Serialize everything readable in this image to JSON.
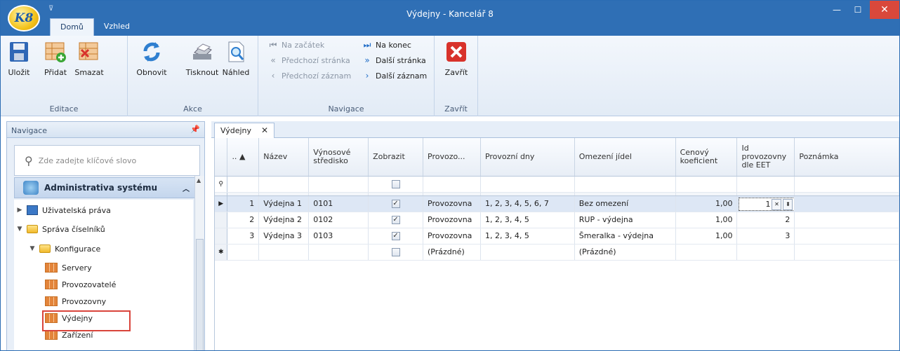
{
  "window": {
    "title": "Výdejny - Kancelář 8",
    "logo_text": "K8",
    "qat_symbol": "⊽"
  },
  "ribbon_tabs": [
    "Domů",
    "Vzhled"
  ],
  "ribbon": {
    "editace": {
      "label": "Editace",
      "save": "Uložit",
      "add": "Přidat",
      "delete": "Smazat"
    },
    "akce": {
      "label": "Akce",
      "refresh": "Obnovit",
      "print": "Tisknout",
      "preview": "Náhled"
    },
    "navigace": {
      "label": "Navigace",
      "first": "Na začátek",
      "prev_page": "Předchozí stránka",
      "prev_record": "Předchozí záznam",
      "last": "Na konec",
      "next_page": "Další stránka",
      "next_record": "Další záznam"
    },
    "zavrit": {
      "label": "Zavřít",
      "close": "Zavřít"
    }
  },
  "nav": {
    "header": "Navigace",
    "search_placeholder": "Zde zadejte klíčové slovo",
    "section": "Administrativa systému",
    "items": {
      "uzivatelska_prava": "Uživatelská práva",
      "sprava_ciselniku": "Správa číselníků",
      "konfigurace": "Konfigurace",
      "servery": "Servery",
      "provozovatele": "Provozovatelé",
      "provozovny": "Provozovny",
      "vydejny": "Výdejny",
      "zarizeni": "Zařízení"
    }
  },
  "doc_tab": "Výdejny",
  "table": {
    "headers": {
      "id": "..",
      "nazev": "Název",
      "vynosove": "Výnosové středisko",
      "zobrazit": "Zobrazit",
      "provozovna": "Provozo...",
      "dny": "Provozní dny",
      "omezeni": "Omezení jídel",
      "koef": "Cenový koeficient",
      "eet": "Id provozovny dle EET",
      "poznamka": "Poznámka"
    },
    "rows": [
      {
        "id": "1",
        "nazev": "Výdejna 1",
        "stredisko": "0101",
        "provozovna": "Provozovna",
        "dny": "1, 2, 3, 4, 5, 6, 7",
        "omezeni": "Bez omezení",
        "koef": "1,00",
        "eet": "1"
      },
      {
        "id": "2",
        "nazev": "Výdejna 2",
        "stredisko": "0102",
        "provozovna": "Provozovna",
        "dny": "1, 2, 3, 4, 5",
        "omezeni": "RUP - výdejna",
        "koef": "1,00",
        "eet": "2"
      },
      {
        "id": "3",
        "nazev": "Výdejna 3",
        "stredisko": "0103",
        "provozovna": "Provozovna",
        "dny": "1, 2, 3, 4, 5",
        "omezeni": "Šmeralka - výdejna",
        "koef": "1,00",
        "eet": "3"
      }
    ],
    "new_row": {
      "provozovna": "(Prázdné)",
      "omezeni": "(Prázdné)"
    }
  }
}
